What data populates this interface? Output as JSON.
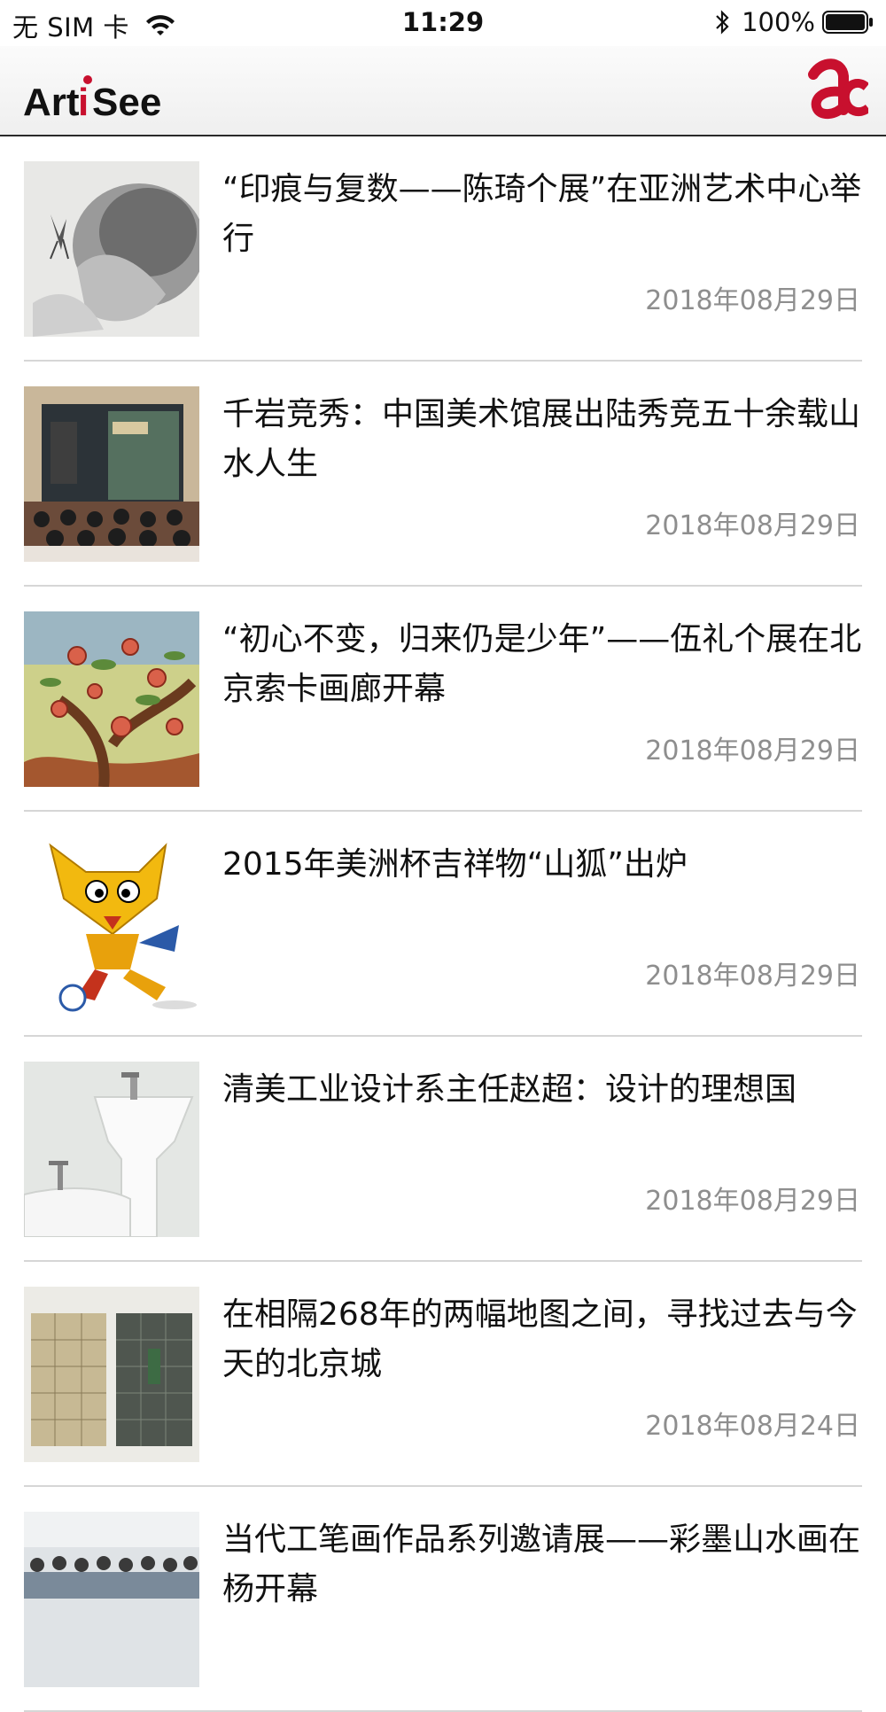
{
  "status_bar": {
    "carrier": "无 SIM 卡",
    "time": "11:29",
    "battery": "100%"
  },
  "nav": {
    "logo_text": "ArtiSee",
    "logo_icon": "ac-logo-icon"
  },
  "articles": [
    {
      "title": "“印痕与复数——陈琦个展”在亚洲艺术中心举行",
      "date": "2018年08月29日",
      "thumb": "ink-butterfly-painting"
    },
    {
      "title": "千岩竞秀：中国美术馆展出陆秀竞五十余载山水人生",
      "date": "2018年08月29日",
      "thumb": "exhibition-opening-photo"
    },
    {
      "title": "“初心不变，归来仍是少年”——伍礼个展在北京索卡画廊开幕",
      "date": "2018年08月29日",
      "thumb": "peach-tree-painting"
    },
    {
      "title": "2015年美洲杯吉祥物“山狐”出炉",
      "date": "2018年08月29日",
      "thumb": "fox-mascot"
    },
    {
      "title": "清美工业设计系主任赵超：设计的理想国",
      "date": "2018年08月29日",
      "thumb": "white-sink-design"
    },
    {
      "title": "在相隔268年的两幅地图之间，寻找过去与今天的北京城",
      "date": "2018年08月24日",
      "thumb": "beijing-maps"
    },
    {
      "title": "当代工笔画作品系列邀请展——彩墨山水画在杨开幕",
      "date": "",
      "thumb": "group-photo"
    }
  ]
}
